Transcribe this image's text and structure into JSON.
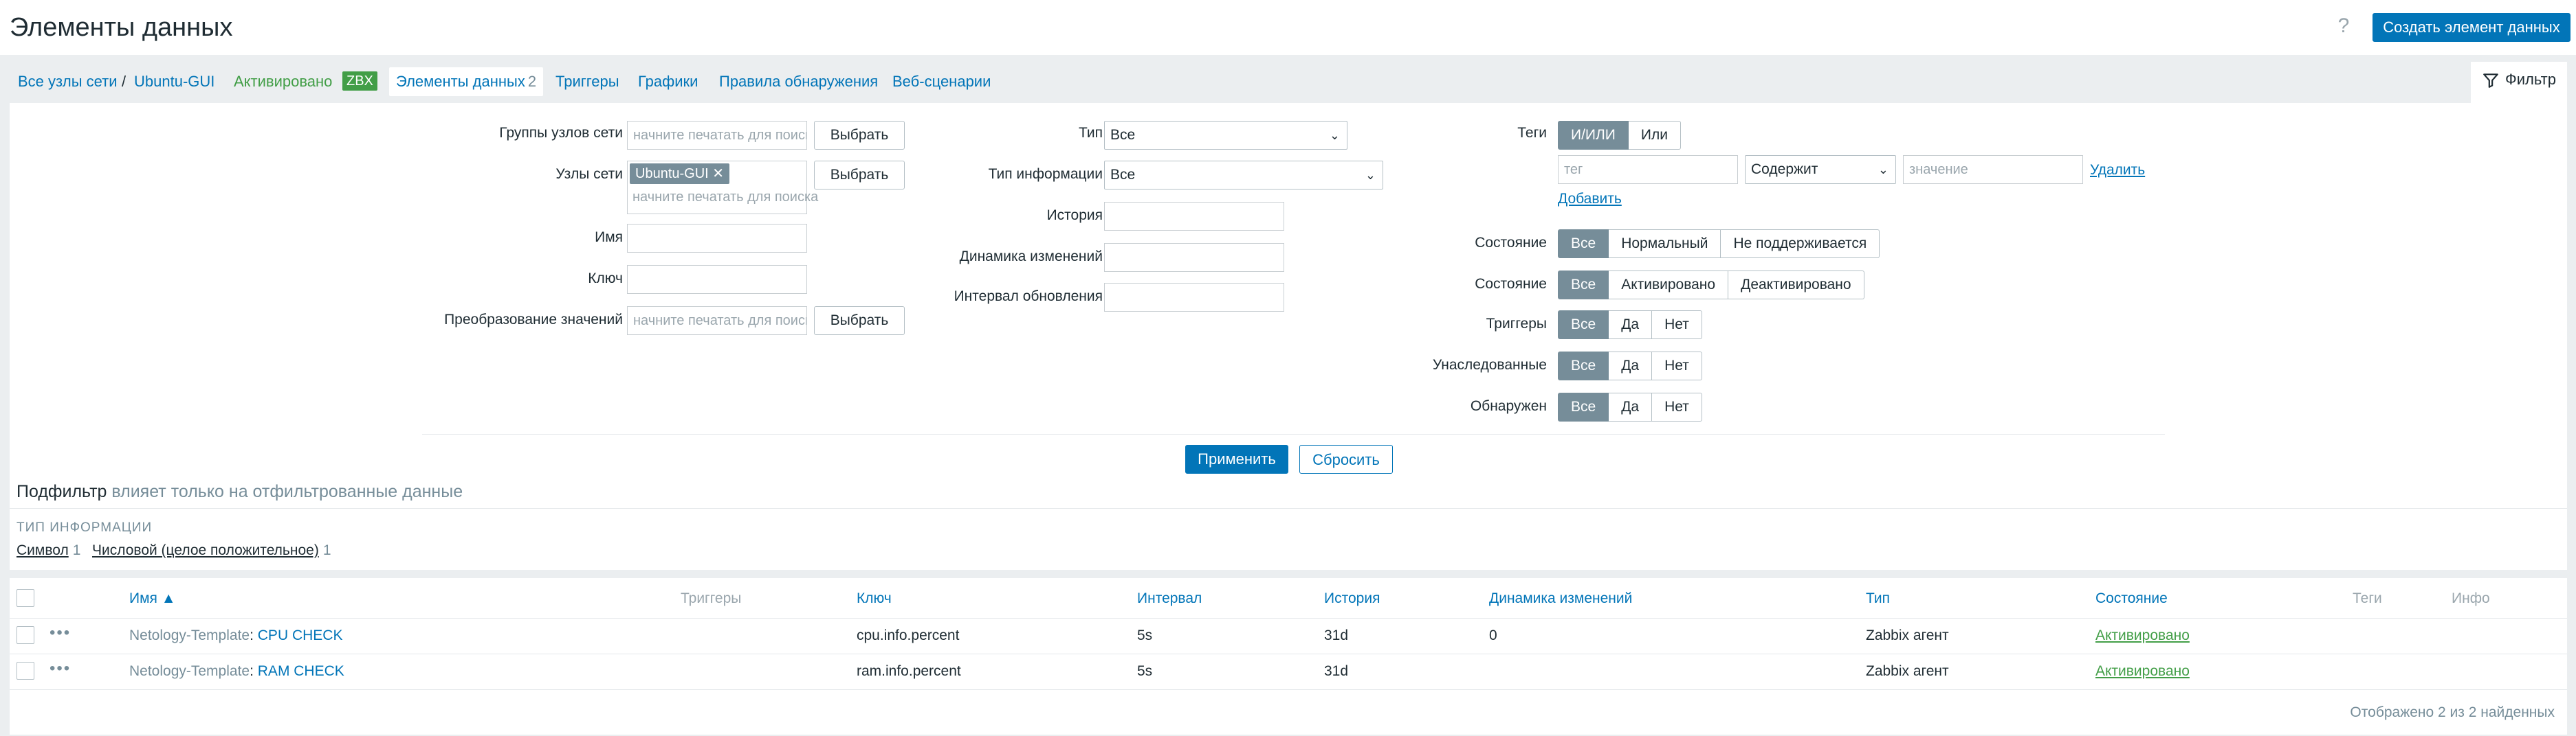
{
  "header": {
    "title": "Элементы данных",
    "create_button": "Создать элемент данных",
    "help_icon": "?"
  },
  "nav": {
    "all_hosts": "Все узлы сети",
    "separator": "/",
    "host": "Ubuntu-GUI",
    "status": "Активировано",
    "badge": "ZBX",
    "items_tab": "Элементы данных",
    "items_count": "2",
    "triggers": "Триггеры",
    "graphs": "Графики",
    "discovery": "Правила обнаружения",
    "web": "Веб-сценарии",
    "filter_tab": "Фильтр"
  },
  "filter": {
    "host_groups_label": "Группы узлов сети",
    "host_groups_placeholder": "начните печатать для поиска",
    "hosts_label": "Узлы сети",
    "hosts_chip": "Ubuntu-GUI",
    "hosts_placeholder": "начните печатать для поиска",
    "name_label": "Имя",
    "key_label": "Ключ",
    "valuemap_label": "Преобразование значений",
    "valuemap_placeholder": "начните печатать для поиска",
    "select_button": "Выбрать",
    "type_label": "Тип",
    "type_value": "Все",
    "info_type_label": "Тип информации",
    "info_type_value": "Все",
    "history_label": "История",
    "trends_label": "Динамика изменений",
    "interval_label": "Интервал обновления",
    "tags_label": "Теги",
    "tags_andor": "И/ИЛИ",
    "tags_or": "Или",
    "tag_placeholder": "тег",
    "tag_operator": "Содержит",
    "tag_value_placeholder": "значение",
    "tag_remove": "Удалить",
    "tag_add": "Добавить",
    "state_label": "Состояние",
    "state_options": [
      "Все",
      "Нормальный",
      "Не поддерживается"
    ],
    "status_label": "Состояние",
    "status_options": [
      "Все",
      "Активировано",
      "Деактивировано"
    ],
    "triggers_label": "Триггеры",
    "inherited_label": "Унаследованные",
    "discovered_label": "Обнаружен",
    "yesno_options": [
      "Все",
      "Да",
      "Нет"
    ],
    "apply": "Применить",
    "reset": "Сбросить"
  },
  "subfilter": {
    "title": "Подфильтр",
    "title_note": "влияет только на отфильтрованные данные",
    "group_header": "ТИП ИНФОРМАЦИИ",
    "values": [
      {
        "label": "Символ",
        "count": "1"
      },
      {
        "label": "Числовой (целое положительное)",
        "count": "1"
      }
    ]
  },
  "table": {
    "columns": {
      "name": "Имя ▲",
      "triggers": "Триггеры",
      "key": "Ключ",
      "interval": "Интервал",
      "history": "История",
      "trends": "Динамика изменений",
      "type": "Тип",
      "status": "Состояние",
      "tags": "Теги",
      "info": "Инфо"
    },
    "rows": [
      {
        "template": "Netology-Template",
        "name": "CPU CHECK",
        "key": "cpu.info.percent",
        "interval": "5s",
        "history": "31d",
        "trends": "0",
        "type": "Zabbix агент",
        "status": "Активировано"
      },
      {
        "template": "Netology-Template",
        "name": "RAM CHECK",
        "key": "ram.info.percent",
        "interval": "5s",
        "history": "31d",
        "trends": "",
        "type": "Zabbix агент",
        "status": "Активировано"
      }
    ],
    "footer": "Отображено 2 из 2 найденных"
  }
}
